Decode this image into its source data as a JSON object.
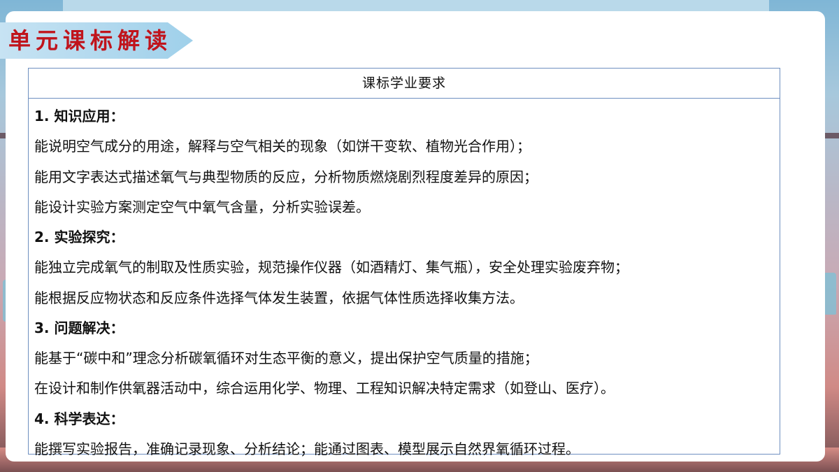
{
  "slide": {
    "title": "单元课标解读",
    "table_header": "课标学业要求",
    "sections": [
      {
        "heading": "1. 知识应用：",
        "lines": [
          "能说明空气成分的用途，解释与空气相关的现象（如饼干变软、植物光合作用）；",
          "能用文字表达式描述氧气与典型物质的反应，分析物质燃烧剧烈程度差异的原因；",
          "能设计实验方案测定空气中氧气含量，分析实验误差。"
        ]
      },
      {
        "heading": "2. 实验探究：",
        "lines": [
          "能独立完成氧气的制取及性质实验，规范操作仪器（如酒精灯、集气瓶），安全处理实验废弃物；",
          "能根据反应物状态和反应条件选择气体发生装置，依据气体性质选择收集方法。"
        ]
      },
      {
        "heading": "3. 问题解决：",
        "lines": [
          "能基于“碳中和”理念分析碳氧循环对生态平衡的意义，提出保护空气质量的措施；",
          "在设计和制作供氧器活动中，综合运用化学、物理、工程知识解决特定需求（如登山、医疗）。"
        ]
      },
      {
        "heading": "4. 科学表达：",
        "lines": [
          "能撰写实验报告，准确记录现象、分析结论；能通过图表、模型展示自然界氧循环过程。"
        ]
      }
    ]
  },
  "colors": {
    "title_red": "#c0141c",
    "banner_blue": "#9fd0ea",
    "table_border": "#6e8fc0"
  }
}
